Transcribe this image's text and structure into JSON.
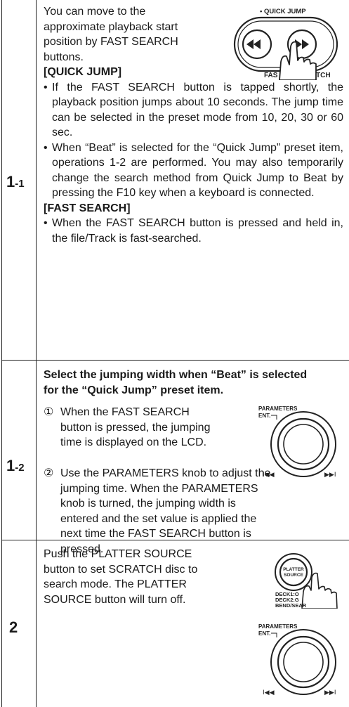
{
  "sections": [
    {
      "step_main": "1",
      "step_sub": "-1",
      "intro": "You can move to the approximate playback start position by FAST SEARCH buttons.",
      "intro_lines": [
        "You can move to the",
        "approximate playback start",
        "position by FAST SEARCH",
        "buttons."
      ],
      "figure_label_top": "• QUICK JUMP",
      "figure_label_bottom": "FAST SEARCH",
      "subsections": [
        {
          "heading": "[QUICK JUMP]",
          "bullets": [
            "If the FAST SEARCH button is tapped shortly, the playback position jumps about 10 seconds. The jump time can be selected in the preset mode from 10, 20, 30 or 60 sec.",
            "When “Beat” is selected for the “Quick Jump” preset item, operations 1-2 are performed. You may also temporarily change the search method from Quick Jump to Beat by pressing the F10 key when a keyboard is connected."
          ]
        },
        {
          "heading": "[FAST SEARCH]",
          "bullets": [
            "When the FAST SEARCH button is pressed and held in, the file/Track is fast-searched."
          ]
        }
      ]
    },
    {
      "step_main": "1",
      "step_sub": "-2",
      "heading": "Select the jumping width when “Beat” is selected for the “Quick Jump” preset item.",
      "items": [
        {
          "marker": "①",
          "text": "When the FAST SEARCH button is pressed, the jumping time is displayed on the LCD."
        },
        {
          "marker": "②",
          "text": "Use the PARAMETERS knob to adjust the jumping time. When the PARAMETERS knob is turned, the jumping width is entered and the set value is applied the next time the FAST SEARCH button is pressed."
        }
      ],
      "figure_label_top": "PARAMETERS",
      "figure_label_ent": "ENT.",
      "figure_prev": "I◀◀",
      "figure_next": "▶▶I"
    },
    {
      "step_main": "2",
      "text": "Push the PLATTER SOURCE button to set SCRATCH disc to search mode. The PLATTER SOURCE button will turn off.",
      "figure_button_line1": "PLATTER",
      "figure_button_line2": "SOURCE",
      "figure_deck_lines": [
        "DECK1:O",
        "DECK2:G",
        "BEND/SEAR"
      ],
      "figure2_label_top": "PARAMETERS",
      "figure2_label_ent": "ENT.",
      "figure2_prev": "I◀◀",
      "figure2_next": "▶▶I"
    }
  ]
}
